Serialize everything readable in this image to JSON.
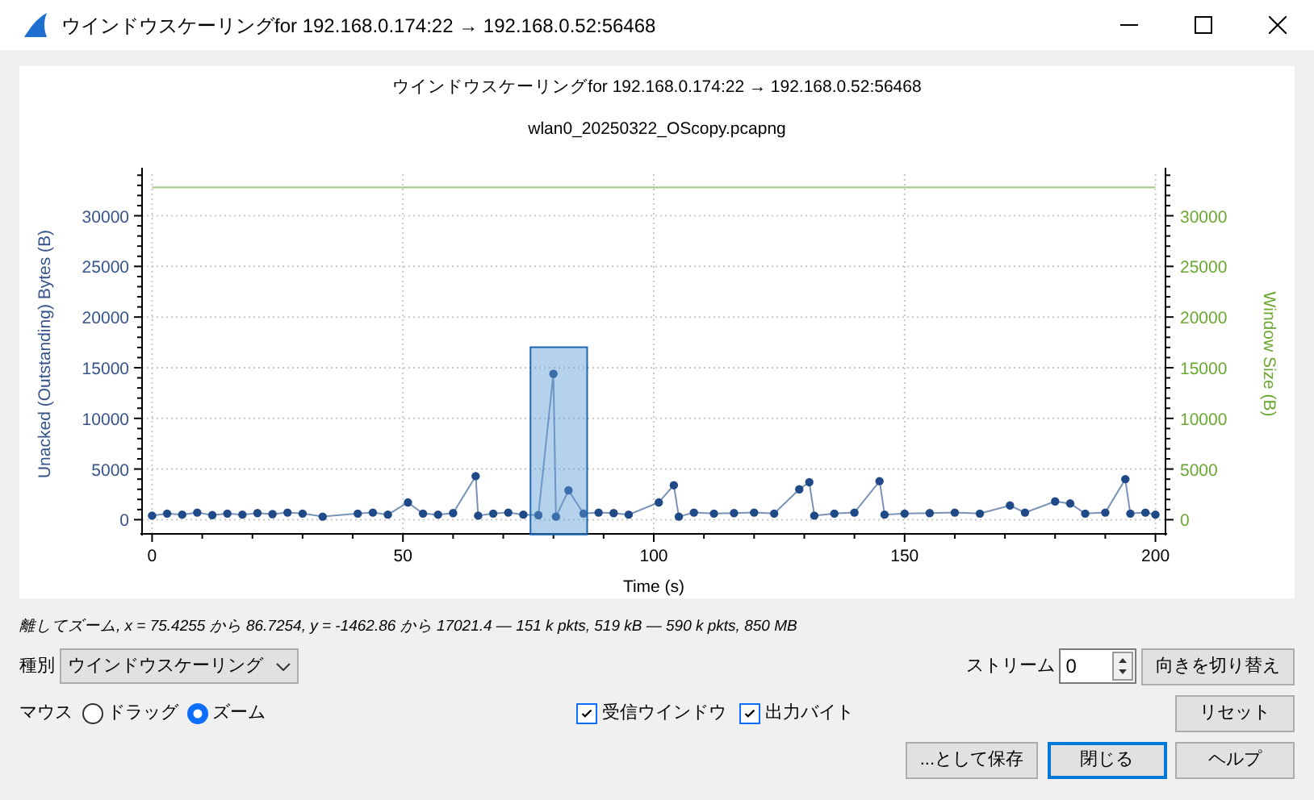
{
  "window": {
    "title": "ウインドウスケーリングfor 192.168.0.174:22 → 192.168.0.52:56468"
  },
  "chart": {
    "title": "ウインドウスケーリングfor 192.168.0.174:22 → 192.168.0.52:56468",
    "subtitle": "wlan0_20250322_OScopy.pcapng",
    "chart_data": {
      "type": "line",
      "grid": true,
      "xlabel": "Time (s)",
      "ylabel": "Unacked (Outstanding) Bytes (B)",
      "y2label": "Window Size (B)",
      "y2ticks": [
        0,
        5000,
        10000,
        15000,
        20000,
        25000,
        30000
      ],
      "y2lim": [
        -1400,
        34100
      ],
      "x": [
        0,
        3,
        6,
        9,
        12,
        15,
        18,
        21,
        24,
        27,
        30,
        34,
        41,
        44,
        47,
        51,
        54,
        57,
        60,
        64.5,
        65,
        68,
        71,
        74,
        77,
        80,
        80.5,
        83,
        86,
        89,
        92,
        95,
        101,
        104,
        105,
        108,
        112,
        116,
        120,
        124,
        129,
        131,
        132,
        136,
        140,
        145,
        146,
        150,
        155,
        160,
        165,
        171,
        174,
        180,
        183,
        186,
        190,
        194,
        195,
        198,
        200
      ],
      "series": [
        {
          "color": "#1f4a87",
          "marker": "o",
          "values": [
            400,
            600,
            500,
            700,
            450,
            600,
            500,
            650,
            550,
            700,
            600,
            300,
            600,
            700,
            500,
            1700,
            600,
            500,
            650,
            4300,
            400,
            600,
            700,
            500,
            450,
            14400,
            300,
            2900,
            600,
            700,
            650,
            500,
            1700,
            3400,
            300,
            700,
            600,
            650,
            700,
            600,
            3000,
            3700,
            400,
            600,
            700,
            3800,
            500,
            600,
            650,
            700,
            600,
            1400,
            700,
            1800,
            1600,
            600,
            700,
            4000,
            600,
            700,
            500
          ]
        },
        {
          "color": "#a8d08d",
          "values": [
            32800,
            null,
            null,
            null,
            null,
            null,
            null,
            null,
            null,
            null,
            null,
            null,
            null,
            null,
            null,
            null,
            null,
            null,
            null,
            null,
            null,
            null,
            null,
            null,
            null,
            null,
            null,
            null,
            null,
            null,
            null,
            null,
            null,
            null,
            null,
            null,
            null,
            null,
            null,
            null,
            null,
            null,
            null,
            null,
            null,
            null,
            null,
            null,
            null,
            null,
            null,
            null,
            null,
            null,
            null,
            null,
            null,
            null,
            null,
            null,
            32800
          ]
        }
      ],
      "xlim": [
        -2,
        202
      ],
      "ylim": [
        -1400,
        34100
      ],
      "xticks": [
        0,
        50,
        100,
        150,
        200
      ],
      "yticks": [
        0,
        5000,
        10000,
        15000,
        20000,
        25000,
        30000
      ]
    }
  },
  "status_text": "離してズーム, x = 75.4255 から 86.7254, y = -1462.86 から 17021.4 — 151 k pkts, 519 kB — 590 k pkts, 850 MB",
  "type_selector": {
    "label": "種別",
    "value": "ウインドウスケーリング"
  },
  "stream": {
    "label": "ストリーム",
    "value": "0",
    "button": "向きを切り替え"
  },
  "mouse": {
    "label": "マウス",
    "options": [
      {
        "label": "ドラッグ",
        "selected": false
      },
      {
        "label": "ズーム",
        "selected": true
      }
    ]
  },
  "checkboxes": [
    {
      "label": "受信ウインドウ",
      "checked": true
    },
    {
      "label": "出力バイト",
      "checked": true
    }
  ],
  "reset_button": "リセット",
  "buttons": [
    {
      "label": "...として保存",
      "default": false
    },
    {
      "label": "閉じる",
      "default": true
    },
    {
      "label": "ヘルプ",
      "default": false
    }
  ]
}
